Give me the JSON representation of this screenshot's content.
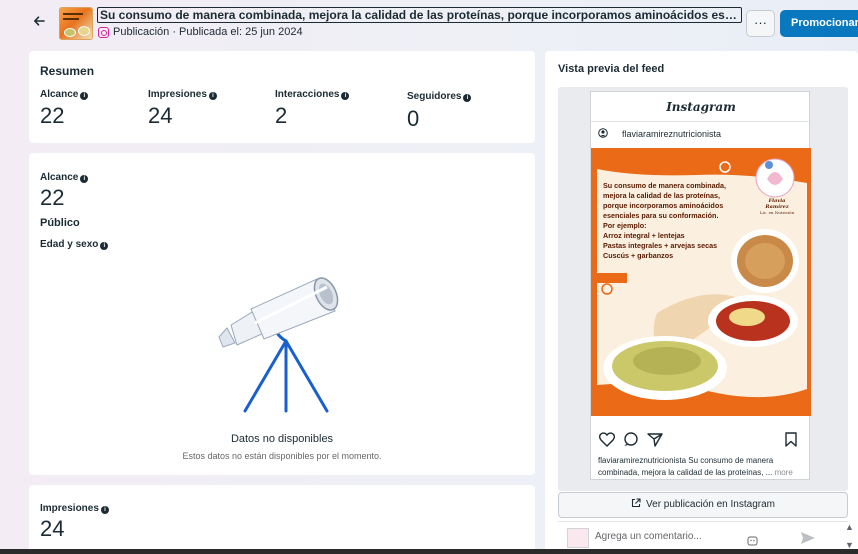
{
  "header": {
    "back_icon": "arrow-left-icon",
    "title": "Su consumo de manera combinada, mejora la calidad de las proteínas, porque incorporamos aminoácidos esenciales para su c...",
    "meta": "Publicación · Publicada el: 25 jun 2024",
    "more_label": "···",
    "promote_label": "Promocionar",
    "accent_color": "#0a78be"
  },
  "resumen": {
    "title": "Resumen",
    "metrics": [
      {
        "label": "Alcance",
        "value": "22"
      },
      {
        "label": "Impresiones",
        "value": "24"
      },
      {
        "label": "Interacciones",
        "value": "2"
      },
      {
        "label": "Seguidores",
        "value": "0"
      }
    ]
  },
  "alcance": {
    "label": "Alcance",
    "value": "22",
    "publico": "Público",
    "edad_sexo": "Edad y sexo",
    "empty_title": "Datos no disponibles",
    "empty_sub": "Estos datos no están disponibles por el momento."
  },
  "impresiones": {
    "label": "Impresiones",
    "value": "24"
  },
  "preview": {
    "title": "Vista previa del feed",
    "ig_logo": "Instagram",
    "username": "flaviaramireznutricionista",
    "image_text": [
      "Su consumo de manera combinada,",
      "mejora la calidad de las proteínas,",
      "porque incorporamos aminoácidos",
      "esenciales para su conformación.",
      "Por ejemplo:",
      "Arroz integral + lentejas",
      "Pastas integrales + arvejas secas",
      "Cuscús + garbanzos"
    ],
    "logo_name": "Flavia Ramírez",
    "logo_sub": "Lic. en Nutrición",
    "caption_user": "flaviaramireznutricionista",
    "caption_text": "Su consumo de manera combinada, mejora la calidad de las proteínas, ...",
    "caption_more": "more",
    "view_button": "Ver publicación en Instagram",
    "comment_placeholder": "Agrega un comentario..."
  }
}
